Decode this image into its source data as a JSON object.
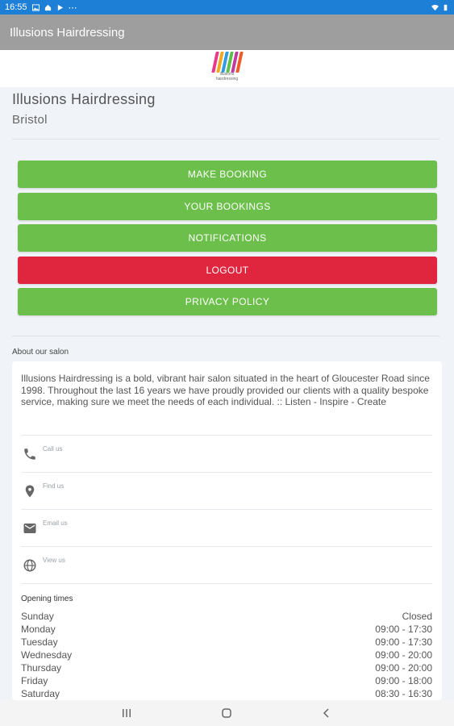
{
  "status_bar": {
    "time": "16:55"
  },
  "app_bar": {
    "title": "Illusions Hairdressing"
  },
  "logo": {
    "tagline": "illusions hairdressing",
    "colors": [
      "#e83a8a",
      "#f2a81d",
      "#2f9be0",
      "#5cbf4a",
      "#c13b9e",
      "#f05a28"
    ]
  },
  "salon": {
    "name": "Illusions Hairdressing",
    "city": "Bristol"
  },
  "buttons": [
    {
      "label": "MAKE BOOKING"
    },
    {
      "label": "YOUR BOOKINGS"
    },
    {
      "label": "NOTIFICATIONS"
    },
    {
      "label": "LOGOUT"
    },
    {
      "label": "PRIVACY POLICY"
    }
  ],
  "about": {
    "title": "About our salon",
    "text": "Illusions Hairdressing is a bold, vibrant hair salon situated in the heart of Gloucester Road since 1998. Throughout the last 16 years we have proudly provided our clients with a quality bespoke service, making sure we meet the needs of each individual. :: Listen - Inspire - Create",
    "contacts": [
      {
        "icon": "phone-icon",
        "label": "Call us"
      },
      {
        "icon": "location-pin-icon",
        "label": "Find us"
      },
      {
        "icon": "email-icon",
        "label": "Email us"
      },
      {
        "icon": "globe-icon",
        "label": "View us"
      }
    ]
  },
  "opening": {
    "title": "Opening times",
    "rows": [
      {
        "day": "Sunday",
        "hours": "Closed"
      },
      {
        "day": "Monday",
        "hours": "09:00 - 17:30"
      },
      {
        "day": "Tuesday",
        "hours": "09:00 - 17:30"
      },
      {
        "day": "Wednesday",
        "hours": "09:00 - 20:00"
      },
      {
        "day": "Thursday",
        "hours": "09:00 - 20:00"
      },
      {
        "day": "Friday",
        "hours": "09:00 - 18:00"
      },
      {
        "day": "Saturday",
        "hours": "08:30 - 16:30"
      }
    ]
  },
  "colors": {
    "status_bar": "#1e7fd6",
    "app_bar": "#9e9e9e",
    "button_green": "#6cbf4a",
    "button_red": "#e0263f"
  }
}
